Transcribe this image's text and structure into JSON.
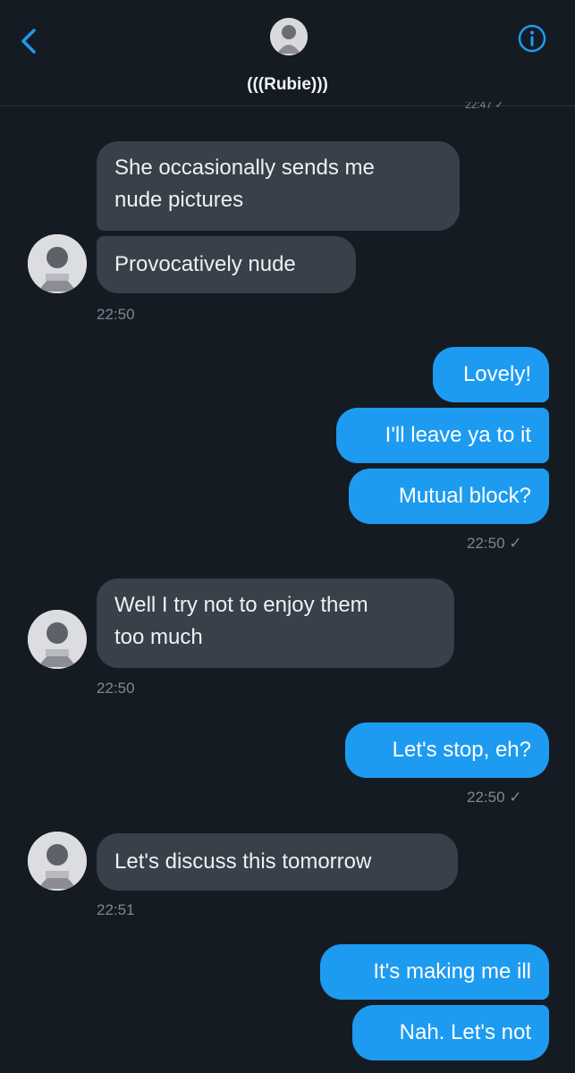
{
  "header": {
    "name": "(((Rubie)))",
    "partial_timestamp": "22:47 ✓"
  },
  "messages": [
    {
      "text_lines": [
        "She occasionally sends me",
        "nude pictures"
      ],
      "direction": "incoming"
    },
    {
      "text": "Provocatively nude",
      "direction": "incoming"
    },
    {
      "time": "22:50"
    },
    {
      "text": "Lovely!",
      "direction": "outgoing"
    },
    {
      "text": "I'll leave ya to it",
      "direction": "outgoing"
    },
    {
      "text": "Mutual block?",
      "direction": "outgoing"
    },
    {
      "time": "22:50 ✓"
    },
    {
      "text_lines": [
        "Well I try not to enjoy them",
        "too much"
      ],
      "direction": "incoming"
    },
    {
      "time": "22:50"
    },
    {
      "text": "Let's stop, eh?",
      "direction": "outgoing"
    },
    {
      "time": "22:50 ✓"
    },
    {
      "text": "Let's discuss this tomorrow",
      "direction": "incoming"
    },
    {
      "time": "22:51"
    },
    {
      "text": "It's making me ill",
      "direction": "outgoing"
    },
    {
      "text": "Nah. Let's not",
      "direction": "outgoing"
    }
  ],
  "colors": {
    "background": "#151b22",
    "incoming_bubble": "#384049",
    "outgoing_bubble": "#1d9bf0",
    "accent": "#1d9bf0",
    "timestamp": "#7d8893"
  },
  "icons": [
    "back-chevron-icon",
    "info-icon",
    "avatar"
  ]
}
